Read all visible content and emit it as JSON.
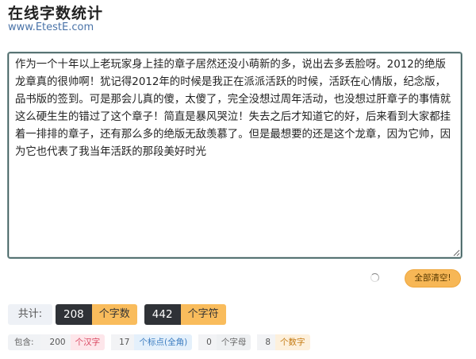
{
  "header": {
    "title": "在线字数统计",
    "site": "www.EtestE.com"
  },
  "editor": {
    "text": "作为一个十年以上老玩家身上挂的章子居然还没小萌新的多，说出去多丢脸呀。2012的绝版龙章真的很帅啊！犹记得2012年的时候是我正在派派活跃的时候，活跃在心情版，纪念版，品书版的签到。可是那会儿真的傻，太傻了，完全没想过周年活动，也没想过肝章子的事情就这么硬生生的错过了这个章子！简直是暴风哭泣！失去之后才知道它的好，后来看到大家都挂着一排排的章子，还有那么多的绝版无敌羡慕了。但是最想要的还是这个龙章，因为它帅，因为它也代表了我当年活跃的那段美好时光"
  },
  "actions": {
    "clear_label": "全部清空!"
  },
  "stats": {
    "total_label": "共计:",
    "word_count": "208",
    "word_unit": "个字数",
    "char_count": "442",
    "char_unit": "个字符"
  },
  "details": {
    "label": "包含:",
    "items": [
      {
        "count": "200",
        "unit": "个汉字",
        "color": "#d9455f"
      },
      {
        "count": "17",
        "unit": "个标点(全角)",
        "color": "#3b7cc0"
      },
      {
        "count": "0",
        "unit": "个字母",
        "color": "#666666"
      },
      {
        "count": "8",
        "unit": "个数字",
        "color": "#c47a12"
      }
    ]
  }
}
